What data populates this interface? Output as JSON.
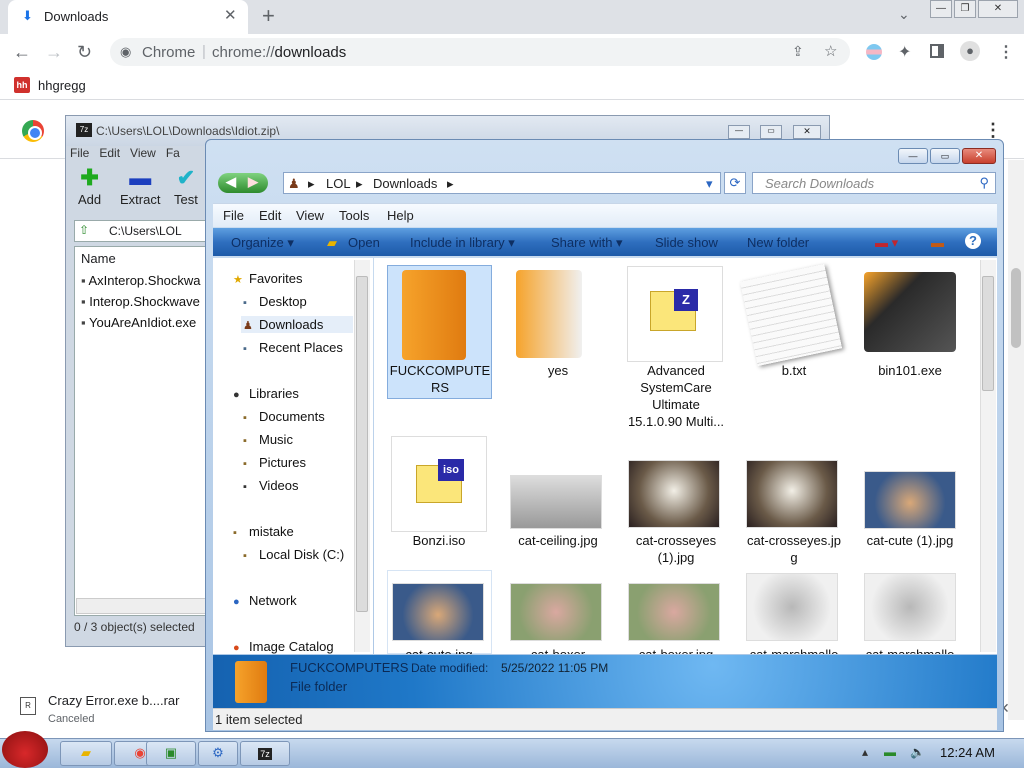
{
  "browser": {
    "tab_title": "Downloads",
    "tab_close": "✕",
    "new_tab": "+",
    "omnibox_site": "Chrome",
    "omnibox_sep": "|",
    "omnibox_scheme": "chrome://",
    "omnibox_path": "downloads",
    "bookmark_icon": "hh",
    "bookmark_label": "hhgregg"
  },
  "shelf": {
    "file_name": "Crazy Error.exe b....rar",
    "status": "Canceled"
  },
  "sevenzip": {
    "title": "C:\\Users\\LOL\\Downloads\\Idiot.zip\\",
    "menu": [
      "File",
      "Edit",
      "View",
      "Fa"
    ],
    "tools": [
      {
        "label": "Add",
        "glyph": "✚"
      },
      {
        "label": "Extract",
        "glyph": "▬"
      },
      {
        "label": "Test",
        "glyph": "✔"
      }
    ],
    "path": "C:\\Users\\LOL",
    "column_name": "Name",
    "files": [
      "AxInterop.Shockwa",
      "Interop.Shockwave",
      "YouAreAnIdiot.exe"
    ],
    "status": "0 / 3 object(s) selected"
  },
  "explorer": {
    "breadcrumb": [
      "LOL",
      "Downloads"
    ],
    "search_placeholder": "Search Downloads",
    "menu": [
      "File",
      "Edit",
      "View",
      "Tools",
      "Help"
    ],
    "commands": [
      "Organize ▾",
      "Open",
      "Include in library ▾",
      "Share with ▾",
      "Slide show",
      "New folder"
    ],
    "nav": {
      "favorites": "Favorites",
      "favorites_items": [
        "Desktop",
        "Downloads",
        "Recent Places"
      ],
      "libraries": "Libraries",
      "library_items": [
        "Documents",
        "Music",
        "Pictures",
        "Videos"
      ],
      "computer": "mistake",
      "computer_items": [
        "Local Disk (C:)"
      ],
      "network": "Network",
      "image_catalog": "Image Catalog"
    },
    "files": [
      {
        "name": "FUCKCOMPUTE RS",
        "thumb": "folder",
        "selected": true
      },
      {
        "name": "yes",
        "thumb": "folder"
      },
      {
        "name": "Advanced SystemCare Ultimate 15.1.0.90 Multi...",
        "thumb": "zip"
      },
      {
        "name": "b.txt",
        "thumb": "text"
      },
      {
        "name": "bin101.exe",
        "thumb": "exe"
      },
      {
        "name": "Bonzi.iso",
        "thumb": "iso"
      },
      {
        "name": "cat-ceiling.jpg",
        "thumb": "photo"
      },
      {
        "name": "cat-crosseyes (1).jpg",
        "thumb": "photo"
      },
      {
        "name": "cat-crosseyes.jp g",
        "thumb": "photo"
      },
      {
        "name": "cat-cute (1).jpg",
        "thumb": "photo"
      },
      {
        "name": "cat-cute.jpg",
        "thumb": "photo"
      },
      {
        "name": "cat-boxer",
        "thumb": "photo"
      },
      {
        "name": "cat-boxer.jpg",
        "thumb": "photo"
      },
      {
        "name": "cat-marshmallo",
        "thumb": "photo"
      },
      {
        "name": "cat-marshmallo",
        "thumb": "photo"
      }
    ],
    "details": {
      "name": "FUCKCOMPUTERS",
      "date_label": "Date modified:",
      "date_value": "5/25/2022 11:05 PM",
      "type": "File folder"
    },
    "status": "1 item selected"
  },
  "taskbar": {
    "clock": "12:24 AM"
  },
  "colors": {
    "accent": "#1a73e8",
    "explorer_cmdbar": "#2f6fbf",
    "selection": "#cce3fb"
  }
}
